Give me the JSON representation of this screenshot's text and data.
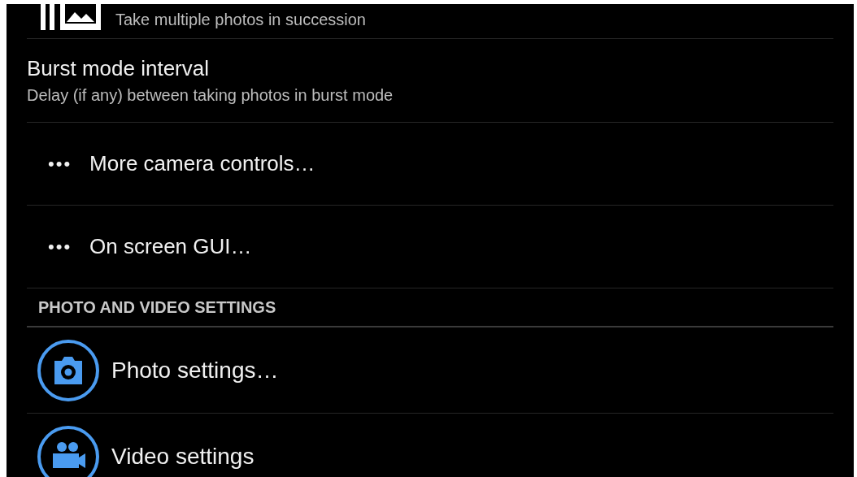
{
  "items": [
    {
      "kind": "setting",
      "subtitle": "Take multiple photos in succession"
    },
    {
      "kind": "setting",
      "title": "Burst mode interval",
      "subtitle": "Delay (if any) between taking photos in burst mode"
    },
    {
      "kind": "more",
      "dots": "•••",
      "label": "More camera controls…"
    },
    {
      "kind": "more",
      "dots": "•••",
      "label": "On screen GUI…"
    },
    {
      "kind": "header",
      "label": "PHOTO AND VIDEO SETTINGS"
    },
    {
      "kind": "link",
      "label": "Photo settings…"
    },
    {
      "kind": "link",
      "label": "Video settings"
    }
  ]
}
